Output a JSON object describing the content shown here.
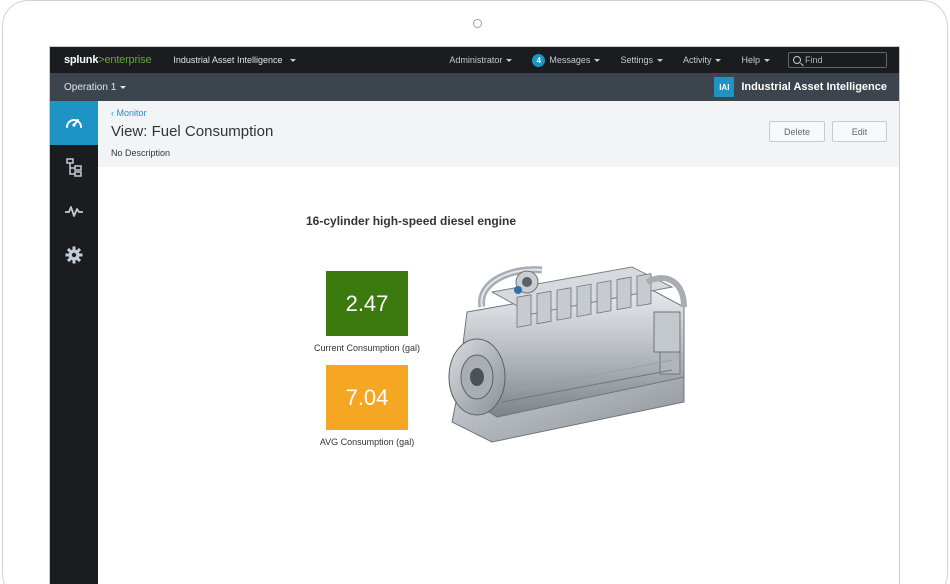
{
  "topbar": {
    "logo_main": "splunk",
    "logo_arrow": ">",
    "logo_suffix": "enterprise",
    "app_menu": "Industrial Asset Intelligence",
    "items": {
      "administrator": "Administrator",
      "messages_count": "4",
      "messages": "Messages",
      "settings": "Settings",
      "activity": "Activity",
      "help": "Help"
    },
    "find_placeholder": "Find"
  },
  "appbar": {
    "operation": "Operation 1",
    "app_badge": "IAI",
    "app_name": "Industrial Asset Intelligence"
  },
  "sidenav": {
    "items": [
      {
        "icon": "speedometer-icon",
        "active": true
      },
      {
        "icon": "hierarchy-tree-icon",
        "active": false
      },
      {
        "icon": "pulse-activity-icon",
        "active": false
      },
      {
        "icon": "gear-icon",
        "active": false
      }
    ]
  },
  "header": {
    "breadcrumb": "Monitor",
    "title": "View: Fuel Consumption",
    "description": "No Description",
    "delete_label": "Delete",
    "edit_label": "Edit"
  },
  "dashboard": {
    "title": "16-cylinder high-speed diesel engine",
    "current": {
      "value": "2.47",
      "label": "Current Consumption (gal)",
      "color": "#3b7a0f"
    },
    "average": {
      "value": "7.04",
      "label": "AVG Consumption (gal)",
      "color": "#f5a623"
    }
  },
  "colors": {
    "accent": "#1e93c6",
    "topbar_bg": "#1a1c20",
    "appbar_bg": "#3c444d",
    "brand_green": "#65a637"
  }
}
